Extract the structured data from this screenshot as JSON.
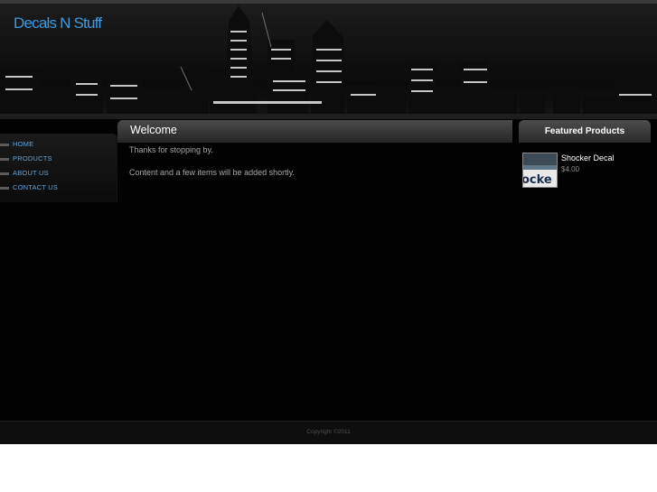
{
  "site": {
    "title": "Decals N Stuff"
  },
  "nav": {
    "items": [
      {
        "label": "HOME"
      },
      {
        "label": "PRODUCTS"
      },
      {
        "label": "ABOUT US"
      },
      {
        "label": "CONTACT US"
      }
    ]
  },
  "main": {
    "heading": "Welcome",
    "paragraphs": [
      "Thanks for stopping by.",
      "Content and a few items will be added shortly."
    ]
  },
  "featured": {
    "heading": "Featured Products",
    "products": [
      {
        "name": "Shocker Decal",
        "price": "$4.00",
        "thumb_text": "ocke"
      }
    ]
  },
  "footer": {
    "copyright": "Copyright ©2011"
  },
  "colors": {
    "accent": "#3d9bde",
    "nav_link": "#62a4d8",
    "background": "#020202",
    "page_bg": "#ffffff"
  }
}
